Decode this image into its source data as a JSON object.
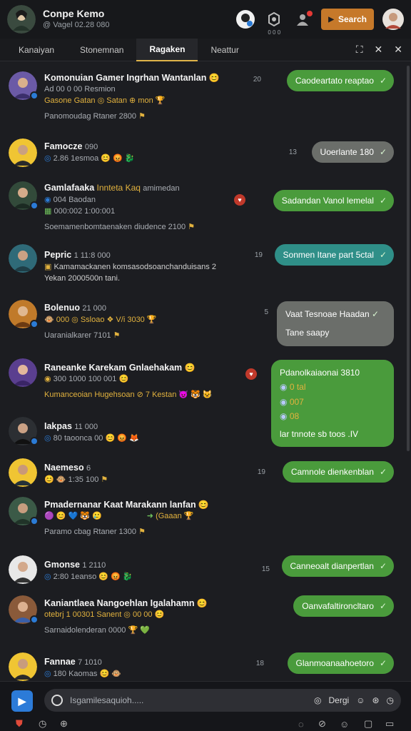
{
  "header": {
    "title": "Conpe Kemo",
    "subtitle": "@ Vagel 02.28 080",
    "icons": [
      "game-avatar-icon",
      "settings-icon",
      "user-icon"
    ],
    "icon_labels": [
      "",
      "0 0 0",
      ""
    ],
    "search_label": "Search",
    "accent_color": "#c6792a"
  },
  "tabs": {
    "items": [
      "Kanaiyan",
      "Stonemnan",
      "Ragaken",
      "Neattur"
    ],
    "active": "Ragaken"
  },
  "chats": [
    {
      "name": "Komonuian Gamer Ingrhan Wantanlan",
      "line2": "Ad 00 0 00 Resmion",
      "line3": "Gasone Gatan ◎ Satan ⊕ mon",
      "line4": "Panomoudag Rtaner 2800",
      "count": "20",
      "bubble": "Caodeartato reaptao"
    },
    {
      "name": "Famocze",
      "name_meta": "090",
      "line2": "2.86 1esmoa",
      "count": "13",
      "bubble": "Uoerlante 180"
    },
    {
      "name": "Gamlafaaka",
      "name_accent": "Innteta Kaq",
      "name_tail": "amimedan",
      "line2": "004 Baodan",
      "line3": "000:002 1:00:001",
      "line4": "Soemamenbomtaenaken diudence 2100",
      "bubble": "Sadandan Vanol lemelal"
    },
    {
      "name": "Pepric",
      "name_meta": "1 11:8 000",
      "line2": "Kamamackanen komsasodsoanchanduisans 2",
      "line3": "Yekan 2000500n tani.",
      "count": "19",
      "bubble": "Sonmen Itane part 5ctal"
    },
    {
      "name": "Bolenuo",
      "name_meta": "21 000",
      "line2": "000 ◎ Ssloao ❖ V/i 3030",
      "line3": "Uaranialkarer 7101",
      "count": "5",
      "bubble_lines": [
        "Vaat Tesnoae Haadan",
        "Tane saapy"
      ]
    },
    {
      "name": "Raneanke Karekam Gnlaehakam",
      "line2": "300 1000 100 001",
      "line3": "Kumanceoian Hugehsoan ⊘ 7 Kestan",
      "bubble_lines": [
        "Pdanolkaiaonai 3810",
        "0 tal",
        "007",
        "08",
        "lar tnnote sb toos .IV"
      ]
    },
    {
      "name": "Iakpas",
      "name_meta": "11 000",
      "line2": "80 taoonca 00",
      "bubble": ""
    },
    {
      "name": "Naemeso",
      "name_meta": "6",
      "line2": "1:35 100",
      "count": "19",
      "bubble": "Camnole dienkenblan"
    },
    {
      "name": "Pmadernanar Kaat Marakann lanfan",
      "line2": "(Gaaan",
      "line3": "Paramo cbag Rtaner 1300",
      "bubble": ""
    },
    {
      "name": "Gmonse",
      "name_meta": "1 2110",
      "line2": "2:80 1eanso",
      "count": "15",
      "bubble": "Canneoalt dianpertlan"
    },
    {
      "name": "Kaniantlaea Nangoehlan Igalahamn",
      "line2": "otebrj 1 00301 Sanent ◎ 00 00",
      "line3": "Sarnaidolenderan 0000",
      "bubble": "Oanvafaltironcltaro"
    },
    {
      "name": "Fannae",
      "name_meta": "7 1010",
      "line2": "180 Kaomas",
      "count": "18",
      "bubble": "Glanmoanaahoetoro"
    }
  ],
  "composer": {
    "placeholder": "Isgamilesaquioh.....",
    "right_label": "Dergi",
    "app_icon": "app-icon"
  },
  "colors": {
    "bubble_green": "#4a9b3c",
    "bubble_gray": "#6b6e6a",
    "bubble_teal": "#2f8f88",
    "accent_gold": "#e2b23e"
  }
}
